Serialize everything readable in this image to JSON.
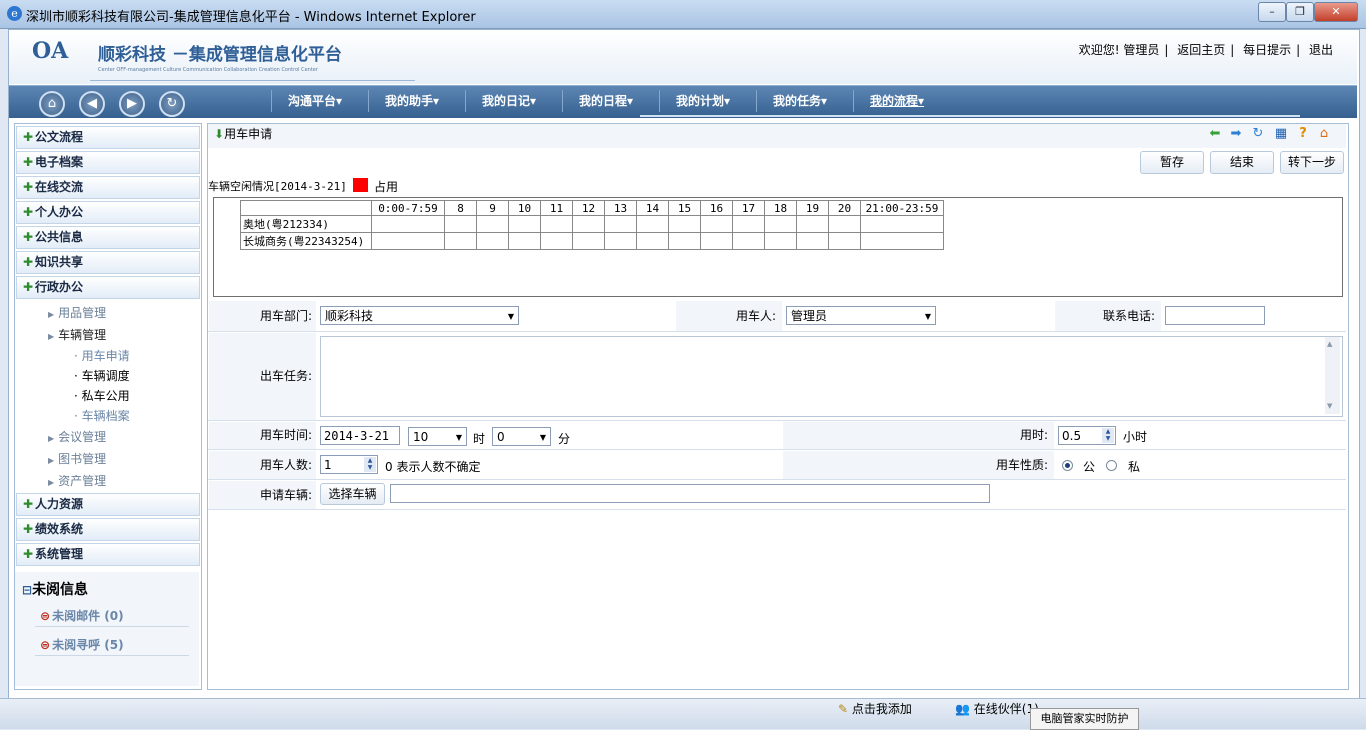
{
  "window": {
    "title": "深圳市顺彩科技有限公司-集成管理信息化平台 - Windows Internet Explorer"
  },
  "header": {
    "logo_oa": "OA",
    "logo_name": "顺彩科技  －集成管理信息化平台",
    "logo_sub": "Center OFF-management   Culture Communication Collaboration Creation Control Center",
    "welcome": "欢迎您! 管理员",
    "links": [
      "返回主页",
      "每日提示",
      "退出"
    ]
  },
  "nav": {
    "items": [
      "沟通平台▾",
      "我的助手▾",
      "我的日记▾",
      "我的日程▾",
      "我的计划▾",
      "我的任务▾",
      "我的流程▾"
    ]
  },
  "sidebar": {
    "sections_top": [
      "公文流程",
      "电子档案",
      "在线交流",
      "个人办公",
      "公共信息",
      "知识共享",
      "行政办公"
    ],
    "admin_sub": [
      "用品管理",
      "车辆管理"
    ],
    "vehicle_sub": [
      "· 用车申请",
      "· 车辆调度",
      "· 私车公用",
      "· 车辆档案"
    ],
    "admin_sub2": [
      "会议管理",
      "图书管理",
      "资产管理"
    ],
    "sections_bottom": [
      "人力资源",
      "绩效系统",
      "系统管理"
    ],
    "unread_title": "未阅信息",
    "unread_mail": "未阅邮件 (0)",
    "unread_call": "未阅寻呼 (5)"
  },
  "main": {
    "title": "用车申请",
    "buttons": {
      "save": "暂存",
      "end": "结束",
      "next": "转下一步"
    },
    "status_label": "车辆空闲情况[2014-3-21]",
    "legend_occupied": "占用",
    "schedule": {
      "headers": [
        "0:00-7:59",
        "8",
        "9",
        "10",
        "11",
        "12",
        "13",
        "14",
        "15",
        "16",
        "17",
        "18",
        "19",
        "20",
        "21:00-23:59"
      ],
      "vehicles": [
        "奥地(粤212334)",
        "长城商务(粤22343254)"
      ]
    },
    "form": {
      "dept_label": "用车部门:",
      "dept_value": "顺彩科技",
      "user_label": "用车人:",
      "user_value": "管理员",
      "phone_label": "联系电话:",
      "phone_value": "",
      "task_label": "出车任务:",
      "task_value": "",
      "time_label": "用车时间:",
      "date_value": "2014-3-21",
      "hour_value": "10",
      "hour_unit": "时",
      "minute_value": "0",
      "minute_unit": "分",
      "duration_label": "用时:",
      "duration_value": "0.5",
      "duration_unit": "小时",
      "people_label": "用车人数:",
      "people_value": "1",
      "people_hint": "0 表示人数不确定",
      "nature_label": "用车性质:",
      "nature_public": "公",
      "nature_private": "私",
      "vehicle_label": "申请车辆:",
      "choose_vehicle": "选择车辆",
      "vehicle_value": ""
    }
  },
  "statusbar": {
    "add_me": "点击我添加",
    "online": "在线伙伴(1)",
    "tooltip": "电脑管家实时防护"
  }
}
